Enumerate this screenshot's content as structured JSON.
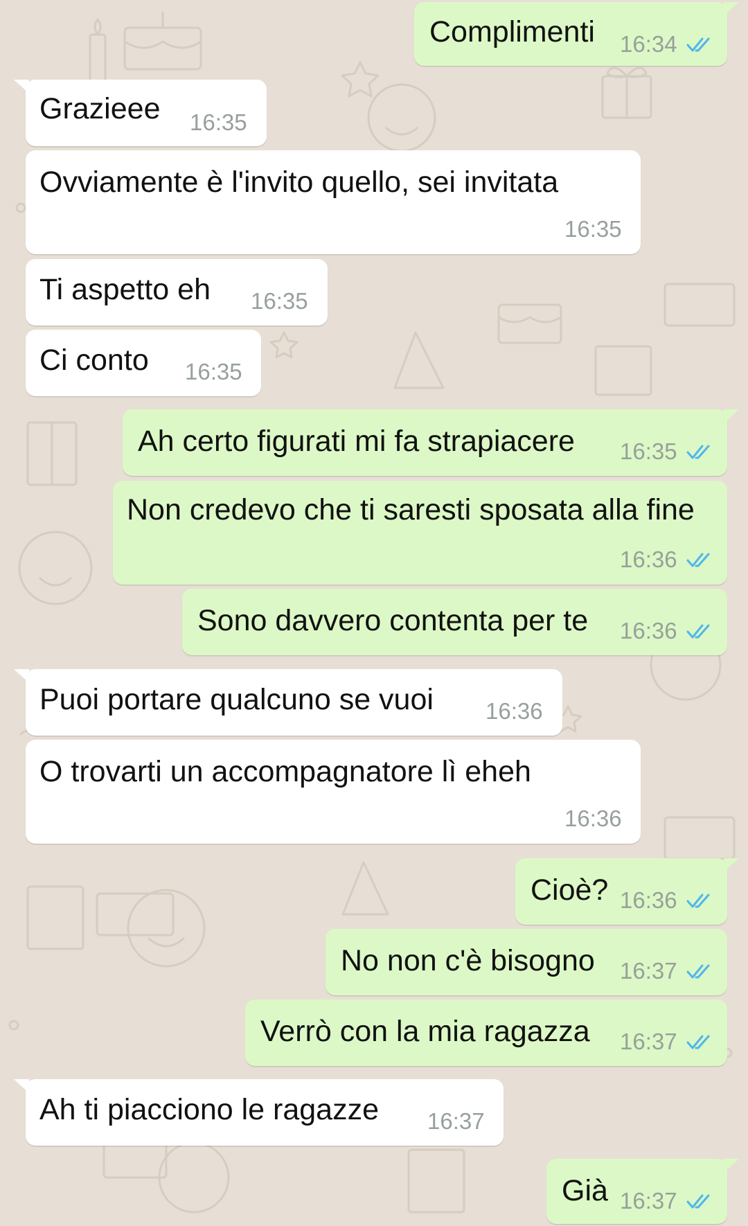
{
  "theme": {
    "incoming_bg": "#ffffff",
    "outgoing_bg": "#dcf8c6",
    "wallpaper_bg": "#e7dfd5",
    "time_color": "#97a09a",
    "read_tick_color": "#4fb6ec"
  },
  "messages": [
    {
      "dir": "out",
      "text": "Complimenti",
      "time": "16:34",
      "read": true
    },
    {
      "dir": "in",
      "text": "Grazieee",
      "time": "16:35"
    },
    {
      "dir": "in",
      "text": "Ovviamente è l'invito quello, sei invitata",
      "time": "16:35"
    },
    {
      "dir": "in",
      "text": "Ti aspetto eh",
      "time": "16:35"
    },
    {
      "dir": "in",
      "text": "Ci conto",
      "time": "16:35"
    },
    {
      "dir": "out",
      "text": "Ah certo figurati mi fa strapiacere",
      "time": "16:35",
      "read": true
    },
    {
      "dir": "out",
      "text": "Non credevo che ti saresti sposata alla fine",
      "time": "16:36",
      "read": true
    },
    {
      "dir": "out",
      "text": "Sono davvero contenta per te",
      "time": "16:36",
      "read": true
    },
    {
      "dir": "in",
      "text": "Puoi portare qualcuno se vuoi",
      "time": "16:36"
    },
    {
      "dir": "in",
      "text": "O trovarti un accompagnatore lì eheh",
      "time": "16:36"
    },
    {
      "dir": "out",
      "text": "Cioè?",
      "time": "16:36",
      "read": true
    },
    {
      "dir": "out",
      "text": "No non c'è bisogno",
      "time": "16:37",
      "read": true
    },
    {
      "dir": "out",
      "text": "Verrò con la mia ragazza",
      "time": "16:37",
      "read": true
    },
    {
      "dir": "in",
      "text": "Ah ti piacciono le ragazze",
      "time": "16:37"
    },
    {
      "dir": "out",
      "text": "Già",
      "time": "16:37",
      "read": true
    }
  ]
}
